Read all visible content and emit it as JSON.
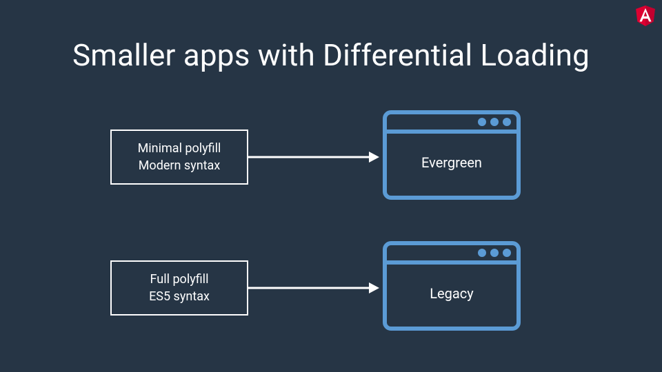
{
  "title": "Smaller apps with Differential Loading",
  "colors": {
    "bg": "#263545",
    "accent": "#5b9bd5",
    "text": "#ffffff",
    "logo": "#dd0031"
  },
  "rows": [
    {
      "input_line1": "Minimal polyfill",
      "input_line2": "Modern syntax",
      "target_label": "Evergreen"
    },
    {
      "input_line1": "Full polyfill",
      "input_line2": "ES5 syntax",
      "target_label": "Legacy"
    }
  ],
  "logo_name": "angular"
}
